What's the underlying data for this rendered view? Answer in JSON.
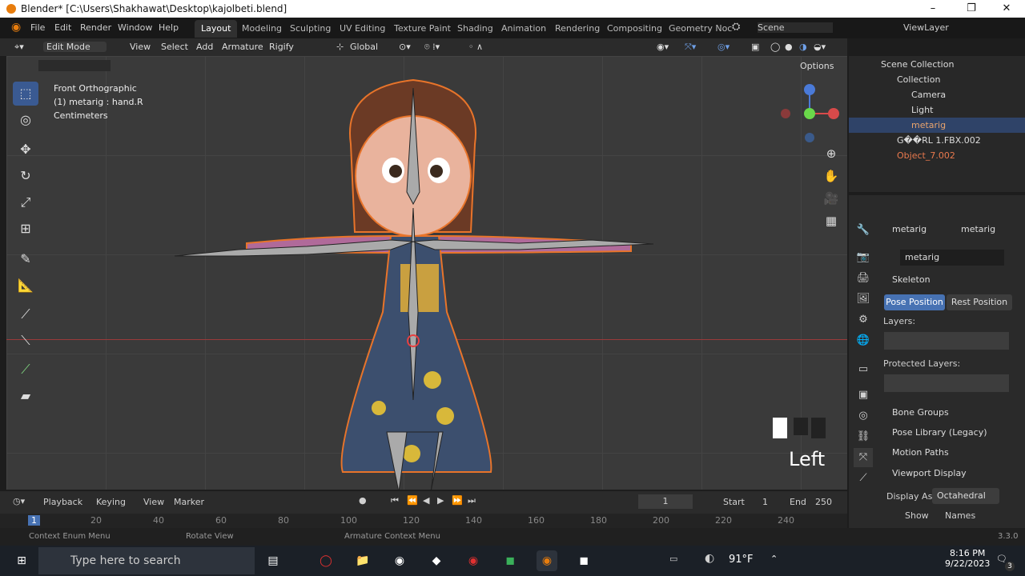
{
  "window": {
    "title": "Blender* [C:\\Users\\Shakhawat\\Desktop\\kajolbeti.blend]",
    "min": "–",
    "max": "❐",
    "close": "✕"
  },
  "menu": {
    "file": "File",
    "edit": "Edit",
    "render": "Render",
    "window": "Window",
    "help": "Help"
  },
  "workspaces": [
    "Layout",
    "Modeling",
    "Sculpting",
    "UV Editing",
    "Texture Paint",
    "Shading",
    "Animation",
    "Rendering",
    "Compositing",
    "Geometry Noc"
  ],
  "scene_label": "Scene",
  "viewlayer_label": "ViewLayer",
  "viewport_header": {
    "mode": "Edit Mode",
    "view": "View",
    "select": "Select",
    "add": "Add",
    "armature": "Armature",
    "rigify": "Rigify",
    "orientation": "Global",
    "options": "Options"
  },
  "viewport_info": {
    "line1": "Front Orthographic",
    "line2": "(1) metarig : hand.R",
    "line3": "Centimeters"
  },
  "overlay_text": "Left",
  "outliner": {
    "root": "Scene Collection",
    "items": [
      {
        "label": "Collection",
        "color": "#dddddd"
      },
      {
        "label": "Camera",
        "color": "#dddddd"
      },
      {
        "label": "Light",
        "color": "#dddddd"
      },
      {
        "label": "metarig",
        "color": "#e9a46d"
      },
      {
        "label": "G��RL 1.FBX.002",
        "color": "#dddddd"
      },
      {
        "label": "Object_7.002",
        "color": "#e9794d"
      }
    ]
  },
  "properties": {
    "breadcrumb1": "metarig",
    "breadcrumb2": "metarig",
    "name_field": "metarig",
    "skeleton": "Skeleton",
    "pose_position": "Pose Position",
    "rest_position": "Rest Position",
    "layers": "Layers:",
    "protected_layers": "Protected Layers:",
    "bone_groups": "Bone Groups",
    "pose_library": "Pose Library (Legacy)",
    "motion_paths": "Motion Paths",
    "viewport_display": "Viewport Display",
    "display_as_label": "Display As",
    "display_as_value": "Octahedral",
    "show_label": "Show",
    "names_label": "Names"
  },
  "timeline": {
    "playback": "Playback",
    "keying": "Keying",
    "view": "View",
    "marker": "Marker",
    "current_frame": "1",
    "start_label": "Start",
    "start": "1",
    "end_label": "End",
    "end": "250",
    "ticks": [
      "1",
      "20",
      "40",
      "60",
      "80",
      "100",
      "120",
      "140",
      "160",
      "180",
      "200",
      "220",
      "240"
    ]
  },
  "status": {
    "left": "Context Enum Menu",
    "mid": "Rotate View",
    "right": "Armature Context Menu",
    "version": "3.3.0"
  },
  "taskbar": {
    "search_placeholder": "Type here to search",
    "weather": "91°F",
    "time": "8:16 PM",
    "date": "9/22/2023",
    "notif_count": "3"
  }
}
